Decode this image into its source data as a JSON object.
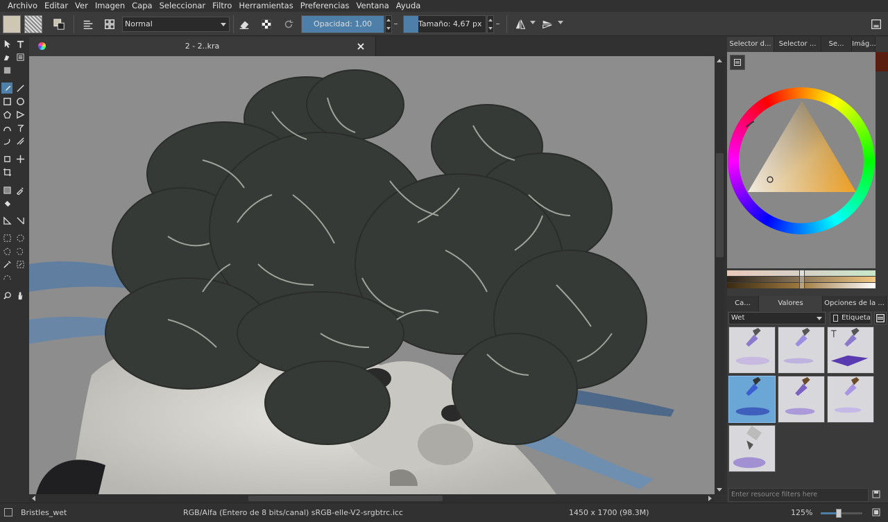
{
  "menu": [
    "Archivo",
    "Editar",
    "Ver",
    "Imagen",
    "Capa",
    "Seleccionar",
    "Filtro",
    "Herramientas",
    "Preferencias",
    "Ventana",
    "Ayuda"
  ],
  "toolbar": {
    "blend_mode": "Normal",
    "opacity_label": "Opacidad:",
    "opacity_value": "1,00",
    "size_label": "Tamaño:",
    "size_value": "4,67 px",
    "opacity_fraction": 1.0
  },
  "document": {
    "tab_title": "2 - 2..kra"
  },
  "right_panel": {
    "top_tabs": [
      "Selector d...",
      "Selector ...",
      "Se...",
      "Imág..."
    ],
    "bottom_tabs": [
      "Ca...",
      "Valores predefini...",
      "Opciones de la ..."
    ],
    "preset_group": "Wet",
    "tag_label": "Etiqueta",
    "filter_placeholder": "Enter resource filters here"
  },
  "status": {
    "brush": "Bristles_wet",
    "color_model": "RGB/Alfa (Entero de 8 bits/canal)  sRGB-elle-V2-srgbtrc.icc",
    "dimensions": "1450 x 1700 (98.3M)",
    "zoom": "125%"
  },
  "colors": {
    "accent": "#4e7fa8",
    "background": "#313131",
    "canvas": "#8a8a8a"
  }
}
